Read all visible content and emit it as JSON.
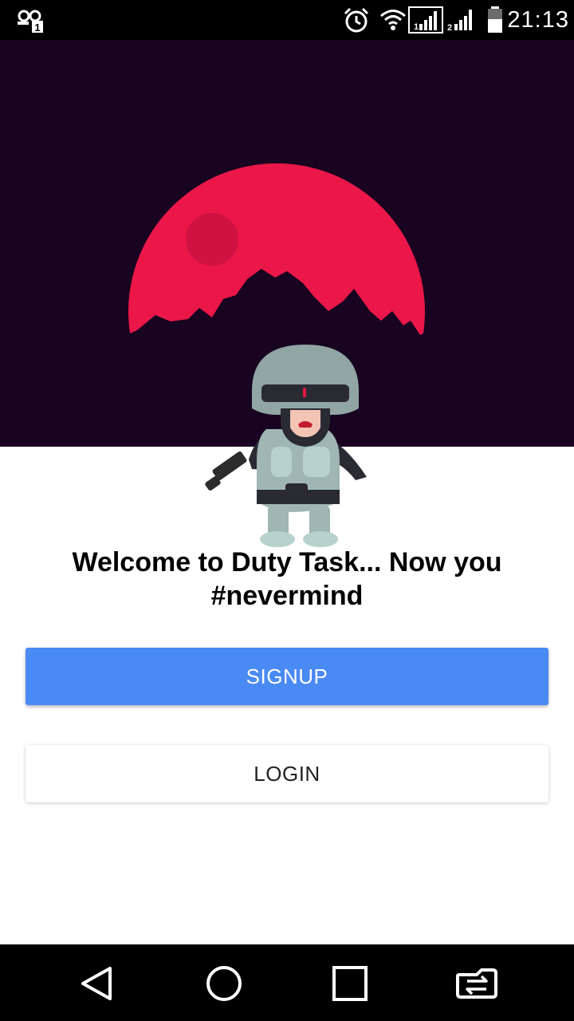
{
  "status_bar": {
    "time": "21:13",
    "icons": [
      "notification-icon",
      "alarm-icon",
      "wifi-icon",
      "signal-sim1-icon",
      "signal-sim2-icon",
      "battery-icon"
    ]
  },
  "hero": {
    "background_color": "#180421",
    "moon_color": "#ea1748",
    "crater_color": "#cf1242"
  },
  "welcome": {
    "line1": "Welcome to Duty Task... Now you",
    "line2": "#nevermind"
  },
  "buttons": {
    "signup_label": "SIGNUP",
    "login_label": "LOGIN",
    "signup_color": "#4a8af4"
  },
  "nav_bar": {
    "icons": [
      "back-icon",
      "home-icon",
      "recents-icon",
      "screen-switch-icon"
    ]
  }
}
